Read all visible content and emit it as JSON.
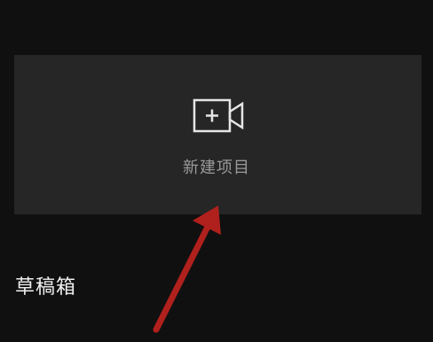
{
  "new_project": {
    "label": "新建项目",
    "icon": "video-camera-plus-icon"
  },
  "drafts": {
    "title": "草稿箱"
  },
  "annotation": {
    "icon": "red-arrow-icon",
    "color": "#b0201c"
  }
}
